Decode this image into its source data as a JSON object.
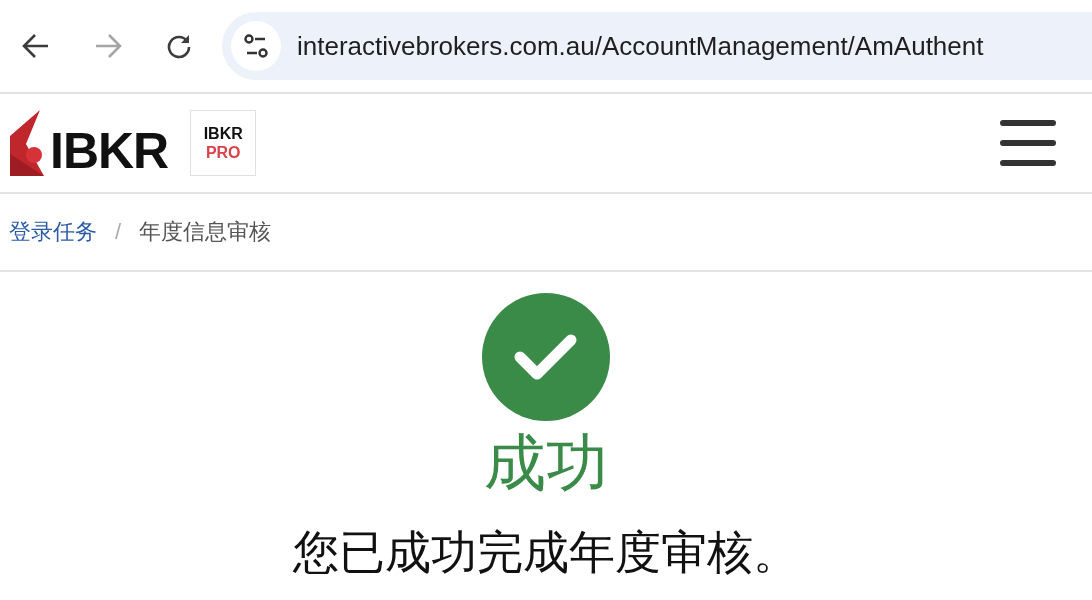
{
  "browser": {
    "back": {
      "disabled": false
    },
    "forward": {
      "disabled": true
    },
    "url": "interactivebrokers.com.au/AccountManagement/AmAuthent"
  },
  "header": {
    "logo_text": "IBKR",
    "badge": {
      "line_1": "IBKR",
      "line_2": "PRO"
    }
  },
  "breadcrumb": {
    "separator": "/",
    "items": [
      {
        "label": "登录任务",
        "kind": "link"
      },
      {
        "label": "年度信息审核",
        "kind": "current"
      }
    ]
  },
  "result": {
    "success": true,
    "title": "成功",
    "message": "您已成功完成年度审核。"
  }
}
